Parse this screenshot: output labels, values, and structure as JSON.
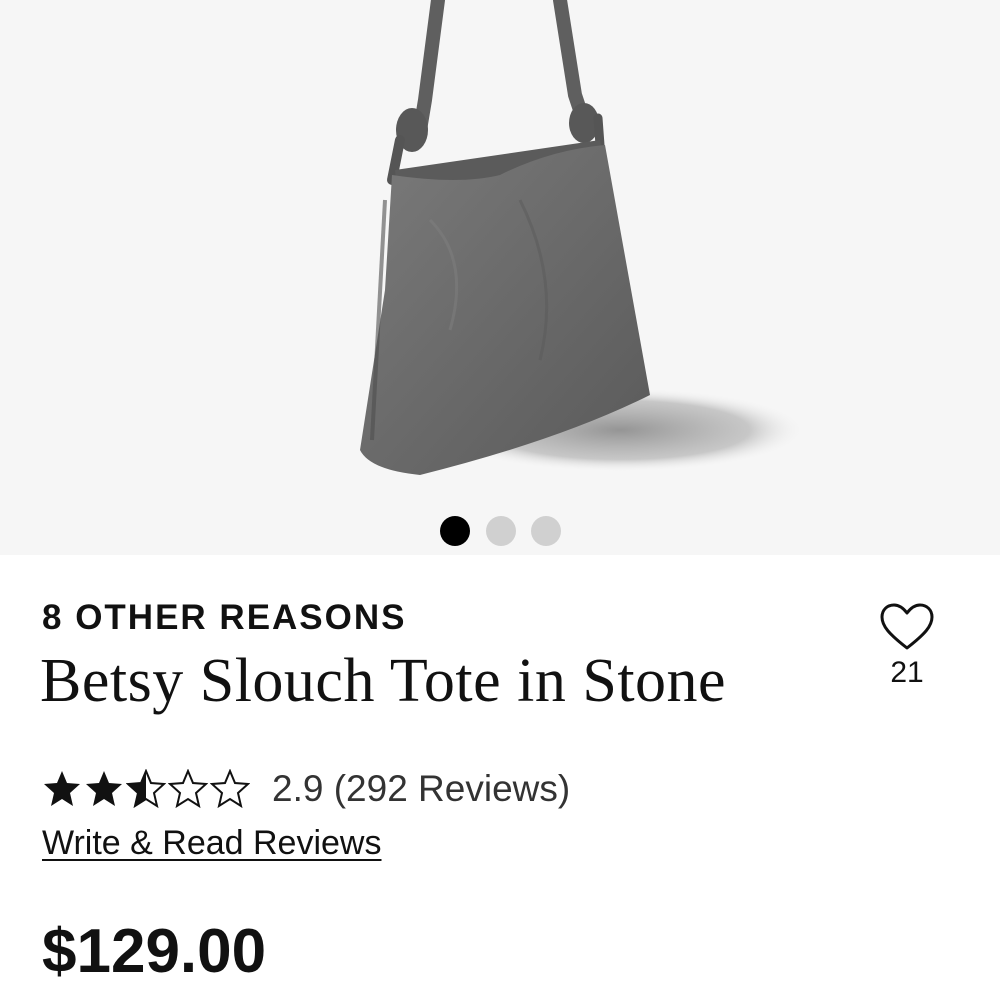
{
  "product": {
    "brand": "8 OTHER REASONS",
    "name": "Betsy Slouch Tote in Stone",
    "price": "$129.00"
  },
  "gallery": {
    "image_count": 3,
    "active_index": 0
  },
  "favorite": {
    "icon": "heart-outline-icon",
    "count": "21"
  },
  "rating": {
    "value": 2.9,
    "stars_filled": 2.5,
    "stars_total": 5,
    "text": "2.9 (292 Reviews)"
  },
  "reviews_link": "Write & Read Reviews",
  "colors": {
    "gallery_background": "#f6f6f6",
    "dot_active": "#000000",
    "dot_inactive": "#d0d0d0",
    "bag": "#6e6e6e"
  }
}
